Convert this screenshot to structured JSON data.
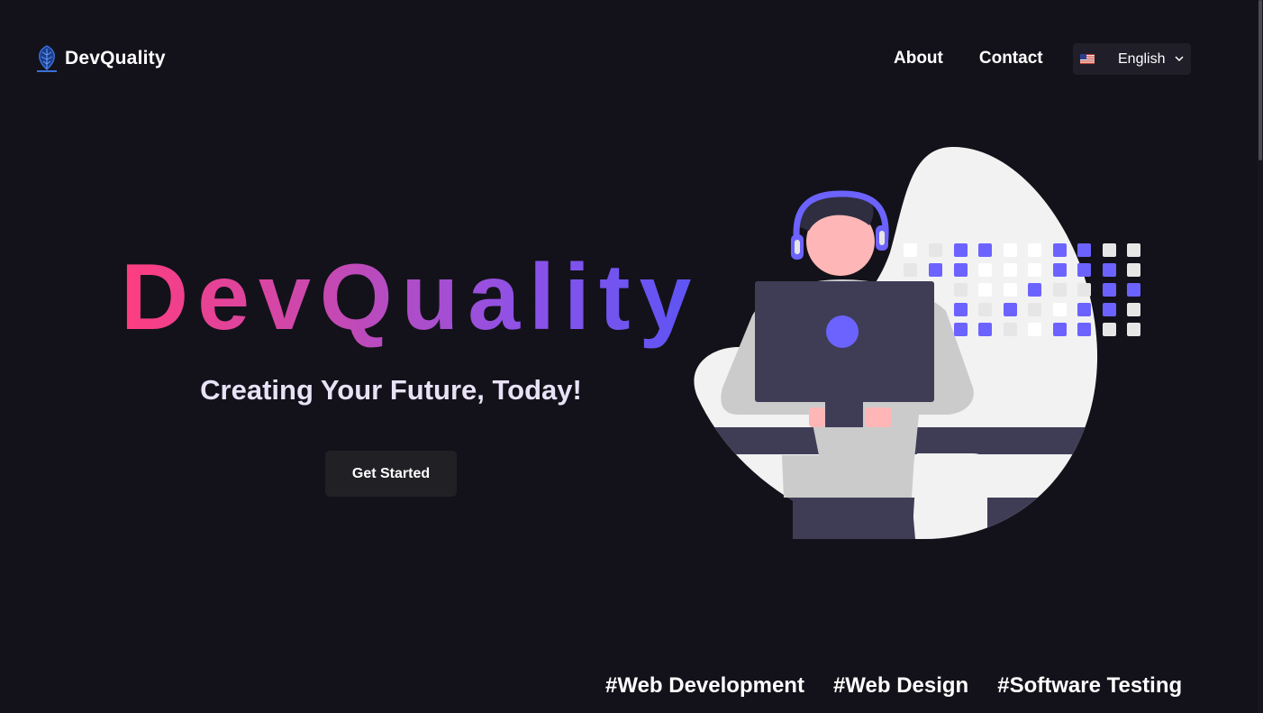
{
  "header": {
    "brand_name": "DevQuality",
    "logo_icon": "leaf-logo-icon",
    "nav": [
      {
        "label": "About"
      },
      {
        "label": "Contact"
      }
    ],
    "language": {
      "flag_icon": "us-flag-icon",
      "selected": "English"
    }
  },
  "hero": {
    "title": "DevQuality",
    "subtitle": "Creating Your Future, Today!",
    "cta_label": "Get Started",
    "illustration": "person-with-headset-at-laptop-illustration"
  },
  "tags": [
    "#Web Development",
    "#Web Design",
    "#Software Testing"
  ],
  "colors": {
    "background": "#13121a",
    "accent": "#6c63ff",
    "gradient_start": "#ff3d7f",
    "gradient_end": "#5b55f5",
    "button": "#212125"
  }
}
